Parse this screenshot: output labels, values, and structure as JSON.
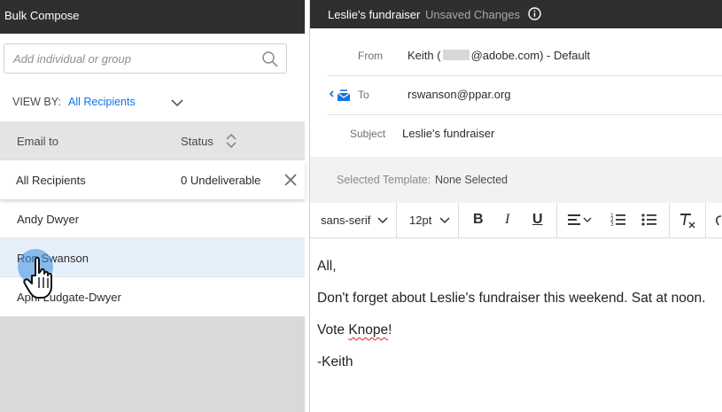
{
  "left_panel": {
    "title": "Bulk Compose",
    "search": {
      "placeholder": "Add individual or group"
    },
    "view_by": {
      "label": "VIEW BY:",
      "value": "All Recipients"
    },
    "table": {
      "columns": [
        "Email to",
        "Status"
      ],
      "all_row": {
        "name": "All Recipients",
        "status": "0 Undeliverable"
      },
      "recipients": [
        "Andy Dwyer",
        "Ron Swanson",
        "April Ludgate-Dwyer"
      ],
      "selected_index": 1
    }
  },
  "right_panel": {
    "title": "Leslie's fundraiser",
    "status": "Unsaved Changes",
    "from": {
      "label": "From",
      "value_prefix": "Keith (",
      "value_suffix": "@adobe.com) - Default"
    },
    "to": {
      "label": "To",
      "value": "rswanson@ppar.org"
    },
    "subject": {
      "label": "Subject",
      "value": "Leslie's fundraiser"
    },
    "template": {
      "label": "Selected Template:",
      "value": "None Selected"
    },
    "toolbar": {
      "font_family": "sans-serif",
      "font_size": "12pt",
      "bold": "B",
      "italic": "I",
      "underline": "U"
    },
    "body": {
      "line1": "All,",
      "line2": "Don't forget about Leslie's fundraiser this weekend. Sat at noon.",
      "line3_prefix": "Vote ",
      "line3_word": "Knope",
      "line3_suffix": "!",
      "line4": "-Keith"
    }
  },
  "colors": {
    "header_bg": "#2f2f2f",
    "accent_blue": "#1473e6",
    "selected_row": "#e6f0fb",
    "panel_gray": "#d9d9d9"
  },
  "icons": [
    "search-icon",
    "chevron-down-icon",
    "sort-icon",
    "close-icon",
    "info-icon",
    "email-to-icon",
    "align-left-icon",
    "numbered-list-icon",
    "bullet-list-icon",
    "clear-format-icon",
    "link-icon",
    "hand-cursor-icon"
  ]
}
